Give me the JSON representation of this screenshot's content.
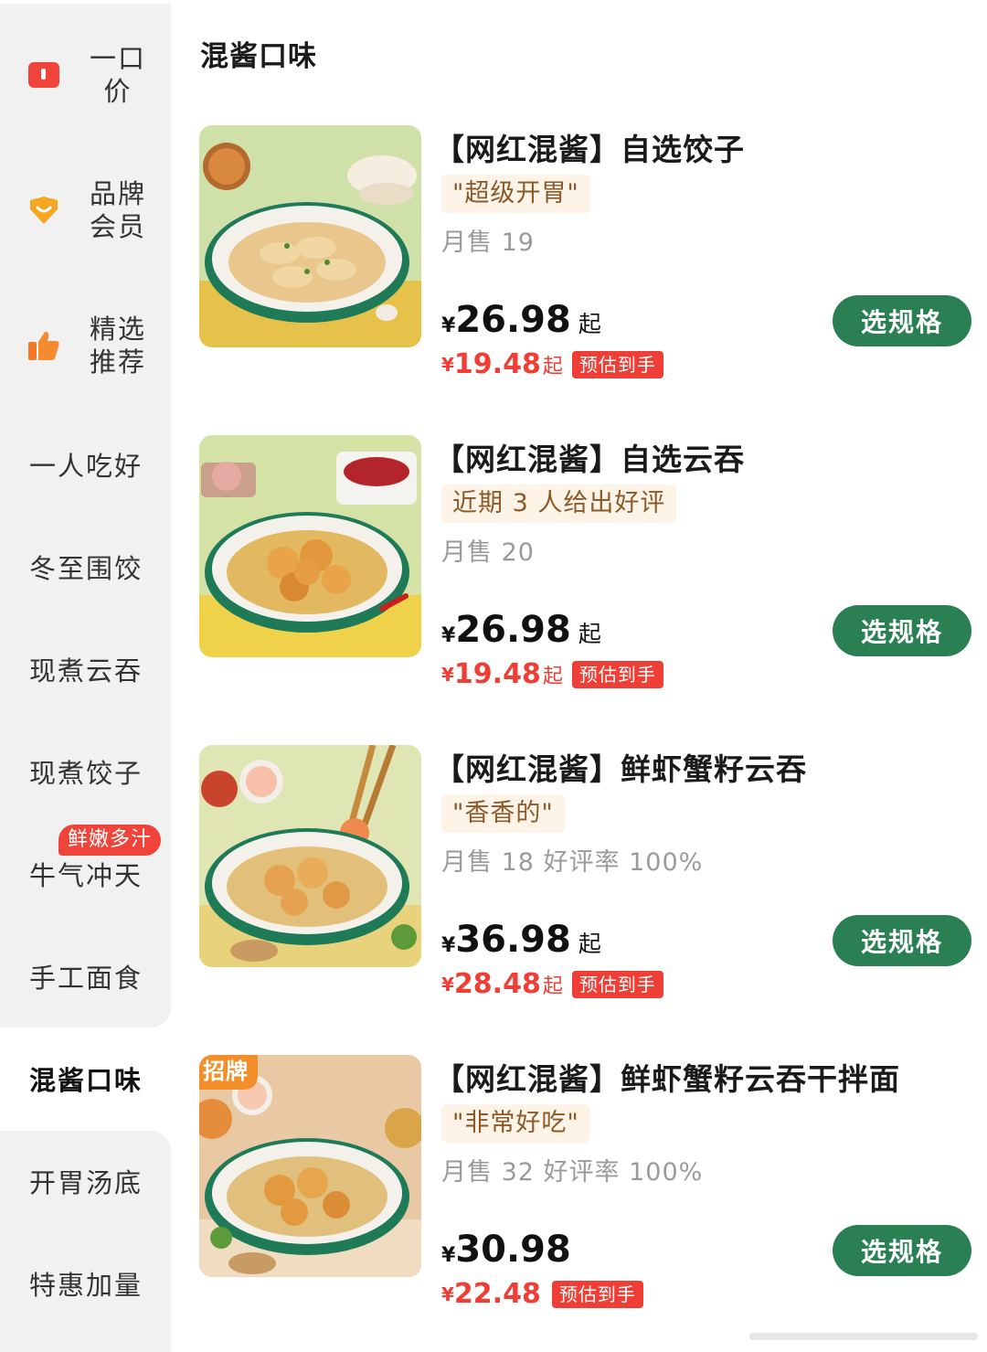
{
  "sidebar": {
    "items": [
      {
        "label_1": "一口",
        "label_2": "价",
        "icon": "flag-red-icon"
      },
      {
        "label_1": "品牌",
        "label_2": "会员",
        "icon": "diamond-heart-icon"
      },
      {
        "label_1": "精选",
        "label_2": "推荐",
        "icon": "thumbs-up-icon"
      },
      {
        "label": "一人吃好"
      },
      {
        "label": "冬至围饺"
      },
      {
        "label": "现煮云吞"
      },
      {
        "label": "现煮饺子"
      },
      {
        "label": "牛气冲天",
        "badge": "鲜嫩多汁"
      },
      {
        "label": "手工面食"
      },
      {
        "label": "混酱口味",
        "active": true
      },
      {
        "label": "开胃汤底"
      },
      {
        "label": "特惠加量"
      }
    ]
  },
  "main": {
    "section_title": "混酱口味",
    "products": [
      {
        "title": "【网红混酱】自选饺子",
        "tag": "\"超级开胃\"",
        "sales": "月售 19",
        "currency": "¥",
        "price": "26.98",
        "price_suffix": "起",
        "discount_price": "19.48",
        "discount_suffix": "起",
        "estimate_label": "预估到手",
        "button": "选规格",
        "image": "dumpling-bowl-photo"
      },
      {
        "title": "【网红混酱】自选云吞",
        "tag": "近期 3 人给出好评",
        "sales": "月售 20",
        "currency": "¥",
        "price": "26.98",
        "price_suffix": "起",
        "discount_price": "19.48",
        "discount_suffix": "起",
        "estimate_label": "预估到手",
        "button": "选规格",
        "image": "wonton-bowl-photo"
      },
      {
        "title": "【网红混酱】鲜虾蟹籽云吞",
        "tag": "\"香香的\"",
        "sales": "月售 18 好评率 100%",
        "currency": "¥",
        "price": "36.98",
        "price_suffix": "起",
        "discount_price": "28.48",
        "discount_suffix": "起",
        "estimate_label": "预估到手",
        "button": "选规格",
        "image": "shrimp-wonton-bowl-photo"
      },
      {
        "title": "【网红混酱】鲜虾蟹籽云吞干拌面",
        "tag": "\"非常好吃\"",
        "sales": "月售 32 好评率 100%",
        "currency": "¥",
        "price": "30.98",
        "price_suffix": "",
        "discount_price": "22.48",
        "discount_suffix": "",
        "estimate_label": "预估到手",
        "button": "选规格",
        "ribbon": "招牌",
        "image": "shrimp-wonton-noodle-photo"
      }
    ]
  },
  "colors": {
    "accent_green": "#2a8053",
    "price_red": "#ef3e36",
    "badge_orange": "#f38f2a",
    "tag_bg": "#fdf3e6"
  }
}
